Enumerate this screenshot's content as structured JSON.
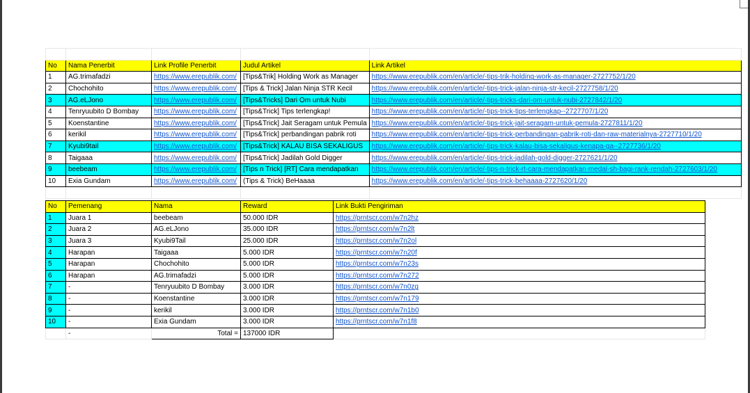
{
  "articles": {
    "headers": [
      "No",
      "Nama Penerbit",
      "Link Profile Penerbit",
      "Judul Artikel",
      "Link Artikel"
    ],
    "rows": [
      {
        "no": "1",
        "penerbit": "AG.trimafadzi",
        "profile": "https://www.erepublik.com/",
        "judul": "[Tips&Trik] Holding Work as Manager",
        "link": "https://www.erepublik.com/en/article/-tips-trik-holding-work-as-manager-2727752/1/20",
        "highlight": false
      },
      {
        "no": "2",
        "penerbit": "Chochohito",
        "profile": "https://www.erepublik.com/",
        "judul": "[Tips & Trick] Jalan Ninja STR Kecil",
        "link": "https://www.erepublik.com/en/article/-tips-trick-jalan-ninja-str-kecil-2727758/1/20",
        "highlight": false
      },
      {
        "no": "3",
        "penerbit": "AG.eLJono",
        "profile": "https://www.erepublik.com/",
        "judul": "[Tips&Tricks] Dari Om untuk Nubi",
        "link": "https://www.erepublik.com/en/article/-tips-tricks-dari-om-untuk-nubi-2727842/1/20",
        "highlight": true
      },
      {
        "no": "4",
        "penerbit": "Tenryuubito D Bombay",
        "profile": "https://www.erepublik.com/",
        "judul": "[Tips&Trick] Tips terlengkap!",
        "link": "https://www.erepublik.com/en/article/-tips-trick-tips-terlengkap--2727707/1/20",
        "highlight": false
      },
      {
        "no": "5",
        "penerbit": "Koenstantine",
        "profile": "https://www.erepublik.com/",
        "judul": "[Tips&Trick] Jait Seragam untuk Pemula",
        "link": "https://www.erepublik.com/en/article/-tips-trick-jait-seragam-untuk-pemula-2727811/1/20",
        "highlight": false
      },
      {
        "no": "6",
        "penerbit": "kerikil",
        "profile": "https://www.erepublik.com/",
        "judul": "[Tips&Trick] perbandingan pabrik roti",
        "link": "https://www.erepublik.com/en/article/-tips-trick-perbandingan-pabrik-roti-dan-raw-materialnya-2727710/1/20",
        "highlight": false
      },
      {
        "no": "7",
        "penerbit": "Kyubi9tail",
        "profile": "https://www.erepublik.com/",
        "judul": "[Tips&Trick] KALAU BISA SEKALIGUS",
        "link": "https://www.erepublik.com/en/article/-tips-trick-kalau-bisa-sekaligus-kenapa-ga--2727736/1/20",
        "highlight": true
      },
      {
        "no": "8",
        "penerbit": "Taigaaa",
        "profile": "https://www.erepublik.com/",
        "judul": "[Tips&Trick] Jadilah Gold Digger",
        "link": "https://www.erepublik.com/en/article/-tips-trick-jadilah-gold-digger-2727621/1/20",
        "highlight": false
      },
      {
        "no": "9",
        "penerbit": "beebeam",
        "profile": "https://www.erepublik.com/",
        "judul": "[Tips n Trick] [RT] Cara mendapatkan",
        "link": "https://www.erepublik.com/en/article/-tips-n-trick-rt-cara-mendapatkan-medal-sh-bagi-rank-rendah-2727603/1/20",
        "highlight": true
      },
      {
        "no": "10",
        "penerbit": "Exia Gundam",
        "profile": "https://www.erepublik.com/",
        "judul": "(Tips & Trick) BeHaaaa",
        "link": "https://www.erepublik.com/en/article/-tips-trick-behaaaa-2727620/1/20",
        "highlight": false
      }
    ]
  },
  "winners": {
    "headers": [
      "No",
      "Pemenang",
      "Nama",
      "Reward",
      "Link Bukti Pengiriman"
    ],
    "rows": [
      {
        "no": "1",
        "pemenang": "Juara 1",
        "nama": "beebeam",
        "reward": "50.000 IDR",
        "link": "https://prntscr.com/w7n2hz"
      },
      {
        "no": "2",
        "pemenang": "Juara 2",
        "nama": "AG.eLJono",
        "reward": "35.000 IDR",
        "link": "https://prntscr.com/w7n2lt"
      },
      {
        "no": "3",
        "pemenang": "Juara 3",
        "nama": "Kyubi9Tail",
        "reward": "25.000 IDR",
        "link": "https://prntscr.com/w7n2ol"
      },
      {
        "no": "4",
        "pemenang": "Harapan",
        "nama": "Taigaaa",
        "reward": "5.000 IDR",
        "link": "https://prntscr.com/w7n20f"
      },
      {
        "no": "5",
        "pemenang": "Harapan",
        "nama": "Chochohito",
        "reward": "5.000 IDR",
        "link": "https://prntscr.com/w7n23s"
      },
      {
        "no": "6",
        "pemenang": "Harapan",
        "nama": "AG.trimafadzi",
        "reward": "5.000 IDR",
        "link": "https://prntscr.com/w7n272"
      },
      {
        "no": "7",
        "pemenang": "-",
        "nama": "Tenryuubito D Bombay",
        "reward": "3.000 IDR",
        "link": "https://prntscr.com/w7n0zg"
      },
      {
        "no": "8",
        "pemenang": "-",
        "nama": "Koenstantine",
        "reward": "3.000 IDR",
        "link": "https://prntscr.com/w7n179"
      },
      {
        "no": "9",
        "pemenang": "-",
        "nama": "kerikil",
        "reward": "3.000 IDR",
        "link": "https://prntscr.com/w7n1b0"
      },
      {
        "no": "10",
        "pemenang": "-",
        "nama": "Exia Gundam",
        "reward": "3.000 IDR",
        "link": "https://prntscr.com/w7n1f8"
      }
    ],
    "total_row": {
      "pemenang": "-",
      "label": "Total =",
      "value": "137000 IDR"
    }
  },
  "colors": {
    "header_fill": "#ffff00",
    "highlight_fill": "#00ffff",
    "link": "#1155cc"
  }
}
